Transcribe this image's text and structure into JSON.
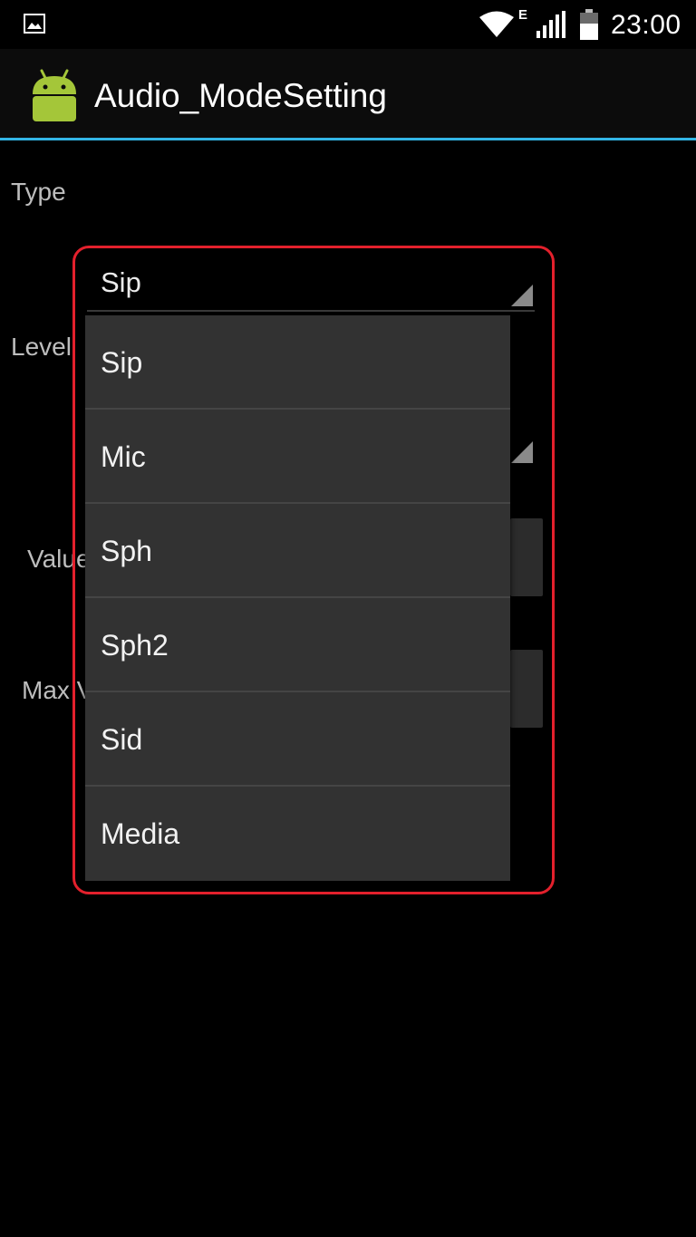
{
  "status_bar": {
    "notification_icon": "image-icon",
    "wifi_icon": "wifi-icon",
    "network_type": "E",
    "signal_icon": "signal-icon",
    "battery_icon": "battery-icon",
    "time": "23:00"
  },
  "action_bar": {
    "logo_icon": "android-icon",
    "title": "Audio_ModeSetting",
    "divider_color": "#33b5e5"
  },
  "form": {
    "type_label": "Type",
    "level_label": "Level",
    "value_label": "Value",
    "max_label": "Max V"
  },
  "spinner": {
    "selected": "Sip",
    "options": [
      "Sip",
      "Mic",
      "Sph",
      "Sph2",
      "Sid",
      "Media"
    ]
  },
  "colors": {
    "highlight": "#e3202c",
    "dropdown_bg": "#323232"
  }
}
